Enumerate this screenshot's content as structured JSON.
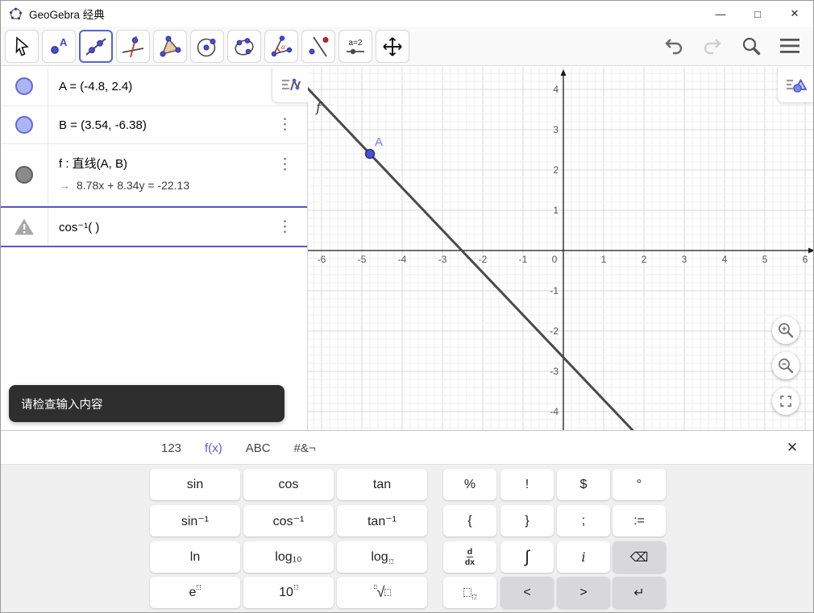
{
  "window": {
    "title": "GeoGebra 经典"
  },
  "titlebar": {
    "minimize": "—",
    "maximize": "□",
    "close": "✕"
  },
  "toolbar": {
    "slider_label": "a=2",
    "tools": [
      {
        "name": "move",
        "selected": false
      },
      {
        "name": "point",
        "label": "A",
        "selected": false
      },
      {
        "name": "line",
        "selected": true
      },
      {
        "name": "perpendicular-line",
        "selected": false
      },
      {
        "name": "polygon",
        "selected": false
      },
      {
        "name": "circle-center-point",
        "selected": false
      },
      {
        "name": "conic",
        "selected": false
      },
      {
        "name": "angle",
        "label": "α",
        "selected": false
      },
      {
        "name": "reflect-about-line",
        "selected": false
      },
      {
        "name": "slider",
        "selected": false
      },
      {
        "name": "move-graphics-view",
        "selected": false
      }
    ],
    "right_icons": [
      "undo-icon",
      "redo-icon",
      "search-icon",
      "menu-icon"
    ]
  },
  "algebra": {
    "rows": [
      {
        "id": "A",
        "icon": "circle-blue",
        "text": "A = (-4.8, 2.4)",
        "kebab": false,
        "active": false
      },
      {
        "id": "B",
        "icon": "circle-blue",
        "text": "B = (3.54, -6.38)",
        "kebab": true,
        "active": false
      },
      {
        "id": "f",
        "icon": "circle-gray",
        "text": "f : 直线(A, B)",
        "sub_arrow": "→",
        "sub": "8.78x + 8.34y = -22.13",
        "kebab": true,
        "active": false
      },
      {
        "id": "input",
        "icon": "warning",
        "text": "cos⁻¹( )",
        "kebab": true,
        "active": true
      }
    ],
    "toast": "请检查输入内容"
  },
  "graph": {
    "unit": 50,
    "x_axis_labels": [
      -6,
      -5,
      -4,
      -3,
      -2,
      -1,
      0,
      1,
      2,
      3,
      4,
      5,
      6
    ],
    "y_axis_labels": [
      4,
      3,
      2,
      1,
      -1,
      -2,
      -3,
      -4
    ],
    "points": [
      {
        "label": "A",
        "x": -4.8,
        "y": 2.4,
        "color": "#4d4fd0",
        "border": "#2a2c96",
        "label_color": "#7b7af2"
      }
    ],
    "lines": [
      {
        "label": "f",
        "through": [
          [
            -4.8,
            2.4
          ],
          [
            3.54,
            -6.38
          ]
        ],
        "color": "#4a4a4a",
        "label_color": "#3c3c3c"
      }
    ],
    "colors": {
      "grid_major": "#d9d9d9",
      "grid_minor": "#efefef",
      "axis": "#1a1a1a",
      "tick_label": "#555555"
    },
    "view_icons": [
      "zoom-in-icon",
      "zoom-out-icon",
      "fullscreen-icon",
      "graphics-stylebar-icon"
    ]
  },
  "keyboard": {
    "tabs": [
      {
        "label": "123",
        "active": false
      },
      {
        "label": "f(x)",
        "active": true
      },
      {
        "label": "ABC",
        "active": false
      },
      {
        "label": "#&¬",
        "active": false
      }
    ],
    "close": "✕",
    "left_keys": [
      [
        {
          "name": "sin",
          "t": "plain",
          "label": "sin"
        },
        {
          "name": "cos",
          "t": "plain",
          "label": "cos"
        },
        {
          "name": "tan",
          "t": "plain",
          "label": "tan"
        }
      ],
      [
        {
          "name": "sin-inverse",
          "t": "plain",
          "label": "sin⁻¹"
        },
        {
          "name": "cos-inverse",
          "t": "plain",
          "label": "cos⁻¹"
        },
        {
          "name": "tan-inverse",
          "t": "plain",
          "label": "tan⁻¹"
        }
      ],
      [
        {
          "name": "ln",
          "t": "plain",
          "label": "ln"
        },
        {
          "name": "log10",
          "t": "plain",
          "label": "log₁₀"
        },
        {
          "name": "log-base",
          "t": "log-box",
          "label": "log"
        }
      ],
      [
        {
          "name": "e-power",
          "t": "e-pow",
          "label": "e"
        },
        {
          "name": "ten-power",
          "t": "ten-pow",
          "label": "10"
        },
        {
          "name": "nth-root",
          "t": "sqrt-box",
          "label": "√"
        }
      ]
    ],
    "right_keys": [
      [
        {
          "name": "percent",
          "t": "plain",
          "label": "%"
        },
        {
          "name": "factorial",
          "t": "plain",
          "label": "!"
        },
        {
          "name": "dollar",
          "t": "plain",
          "label": "$"
        },
        {
          "name": "degree",
          "t": "plain",
          "label": "°"
        }
      ],
      [
        {
          "name": "brace-open",
          "t": "plain",
          "label": "{"
        },
        {
          "name": "brace-close",
          "t": "plain",
          "label": "}"
        },
        {
          "name": "semicolon",
          "t": "plain",
          "label": ";"
        },
        {
          "name": "assign",
          "t": "plain",
          "label": ":="
        }
      ],
      [
        {
          "name": "derivative",
          "t": "ddx",
          "label": "d/dx"
        },
        {
          "name": "integral",
          "t": "plain",
          "label": "∫",
          "big": true
        },
        {
          "name": "imaginary-i",
          "t": "ital",
          "label": "i"
        },
        {
          "name": "backspace",
          "t": "plain",
          "label": "⌫",
          "gray": true
        }
      ],
      [
        {
          "name": "subscript",
          "t": "box-sub",
          "label": "□"
        },
        {
          "name": "cursor-left",
          "t": "plain",
          "label": "<",
          "gray": true
        },
        {
          "name": "cursor-right",
          "t": "plain",
          "label": ">",
          "gray": true
        },
        {
          "name": "enter",
          "t": "plain",
          "label": "↵",
          "gray": true
        }
      ]
    ]
  }
}
